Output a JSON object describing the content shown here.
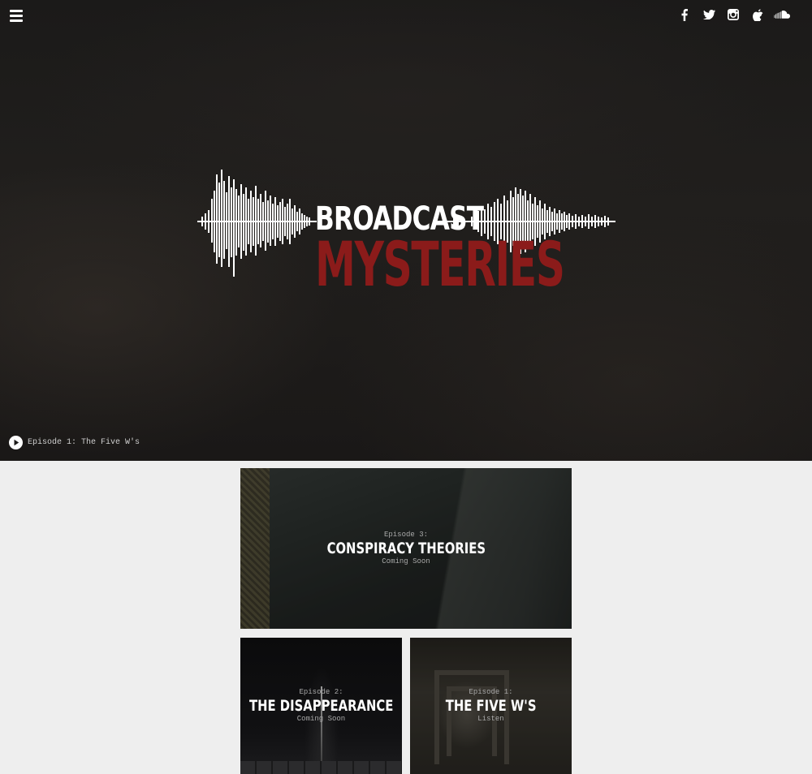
{
  "header": {
    "menu_icon": "hamburger-menu-icon",
    "social_icons": [
      "facebook-icon",
      "twitter-icon",
      "instagram-icon",
      "apple-podcasts-icon",
      "soundcloud-icon"
    ]
  },
  "hero": {
    "logo_line1": "BROADCAST",
    "logo_line2": "MYSTERIES",
    "accent_color": "#8b1b1a",
    "now_playing": "Episode 1: The Five W's"
  },
  "episodes": [
    {
      "number": "Episode 3:",
      "title": "CONSPIRACY THEORIES",
      "status": "Coming Soon"
    },
    {
      "number": "Episode 2:",
      "title": "THE DISAPPEARANCE",
      "status": "Coming Soon"
    },
    {
      "number": "Episode 1:",
      "title": "THE FIVE W'S",
      "status": "Listen"
    }
  ]
}
